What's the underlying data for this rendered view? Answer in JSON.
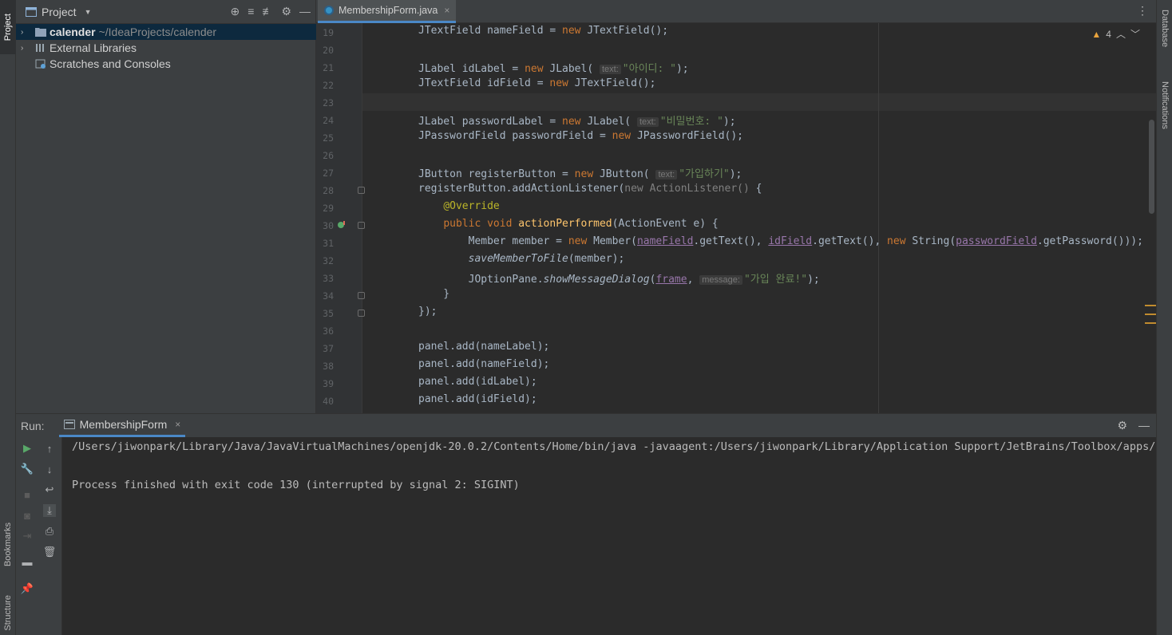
{
  "left_strip": {
    "project_tab": "Project",
    "bookmarks_tab": "Bookmarks",
    "structure_tab": "Structure"
  },
  "right_strip": {
    "database_tab": "Database",
    "notifications_tab": "Notifications"
  },
  "project_panel": {
    "title": "Project",
    "tree": [
      {
        "label": "calender",
        "path": "~/IdeaProjects/calender"
      },
      {
        "label": "External Libraries"
      },
      {
        "label": "Scratches and Consoles"
      }
    ]
  },
  "editor": {
    "tab_name": "MembershipForm.java",
    "warning_count": "4",
    "line_numbers": [
      "19",
      "20",
      "21",
      "22",
      "23",
      "24",
      "25",
      "26",
      "27",
      "28",
      "29",
      "30",
      "31",
      "32",
      "33",
      "34",
      "35",
      "36",
      "37",
      "38",
      "39",
      "40"
    ],
    "hints": {
      "text": "text:",
      "message": "message:"
    },
    "strings": {
      "id": "\"아이디: \"",
      "password": "\"비밀번호: \"",
      "register": "\"가입하기\"",
      "done": "\"가입 완료!\""
    }
  },
  "run_panel": {
    "label": "Run:",
    "tab_name": "MembershipForm",
    "console_line1": "/Users/jiwonpark/Library/Java/JavaVirtualMachines/openjdk-20.0.2/Contents/Home/bin/java -javaagent:/Users/jiwonpark/Library/Application Support/JetBrains/Toolbox/apps/IDE",
    "console_line2": "Process finished with exit code 130 (interrupted by signal 2: SIGINT)"
  },
  "colors": {
    "accent": "#4a88c7",
    "keyword": "#cc7832",
    "string": "#6a8759",
    "field": "#9876aa",
    "function": "#ffc66d"
  }
}
